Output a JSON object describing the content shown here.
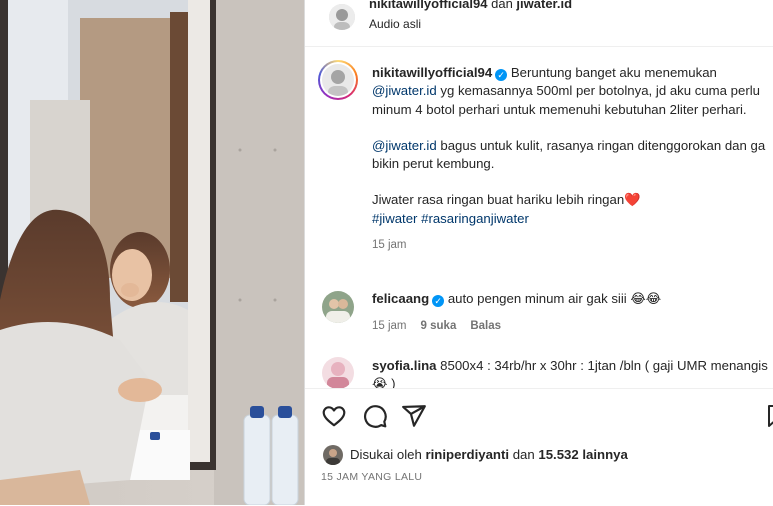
{
  "header": {
    "title_user1": "nikitawillyofficial94",
    "title_connector": " dan ",
    "title_user2": "jiwater.id",
    "audio": "Audio asli"
  },
  "caption": {
    "username": "nikitawillyofficial94",
    "p1_text1": "Beruntung banget aku menemukan ",
    "p1_mention": "@jiwater.id",
    "p1_text2": " yg kemasannya 500ml per botolnya, jd aku cuma perlu minum 4 botol perhari untuk memenuhi kebutuhan 2liter perhari.",
    "p2_mention": "@jiwater.id",
    "p2_text": " bagus untuk kulit, rasanya ringan ditenggorokan dan ga bikin perut kembung.",
    "p3_text": "Jiwater rasa ringan buat hariku lebih ringan",
    "p3_emoji": "❤️",
    "hashtag1": "#jiwater",
    "hashtag2": "#rasaringanjiwater",
    "time": "15 jam"
  },
  "comments": [
    {
      "username": "felicaang",
      "text": "auto pengen minum air gak siii",
      "emojis": "😂😂",
      "time": "15 jam",
      "likes": "9 suka",
      "reply": "Balas"
    },
    {
      "username": "syofia.lina",
      "text": "8500x4 : 34rb/hr x 30hr : 1jtan /bln ( gaji UMR menangis",
      "emojis": "😭",
      "tail": " )"
    }
  ],
  "likes": {
    "prefix": "Disukai oleh ",
    "user": "riniperdiyanti",
    "middle": " dan ",
    "count": "15.532 lainnya"
  },
  "timestamp": "15 JAM YANG LALU",
  "icons": [
    "heart-icon",
    "comment-icon",
    "share-icon",
    "bookmark-icon",
    "verified-icon"
  ],
  "colors": {
    "link": "#00376b",
    "verified": "#0095f6",
    "muted": "#737373",
    "border": "#dbdbdb"
  }
}
